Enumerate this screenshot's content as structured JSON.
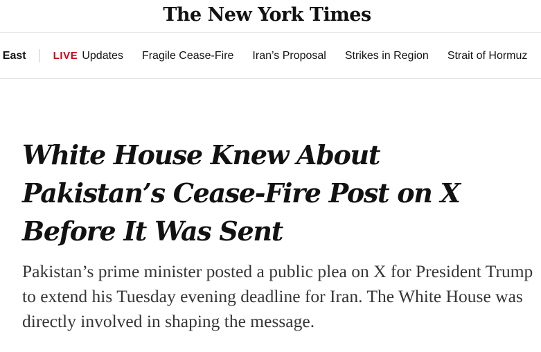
{
  "masthead": {
    "logo_text": "The New York Times"
  },
  "subnav": {
    "section": "le East",
    "live_label": "LIVE",
    "live_text": "Updates",
    "items": [
      "Fragile Cease-Fire",
      "Iran’s Proposal",
      "Strikes in Region",
      "Strait of Hormuz"
    ]
  },
  "article": {
    "headline": "White House Knew About Pakistan’s Cease-Fire Post on X Before It Was Sent",
    "summary": "Pakistan’s prime minister posted a public plea on X for President Trump to extend his Tuesday evening deadline for Iran. The White House was directly involved in shaping the message."
  },
  "colors": {
    "live_red": "#d0021b",
    "text": "#121212",
    "summary_text": "#363636",
    "rule": "#dfdfdf"
  }
}
